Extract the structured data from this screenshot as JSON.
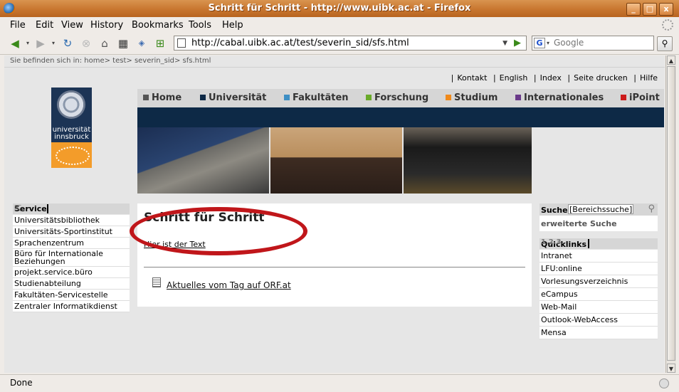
{
  "window": {
    "title": "Schritt für Schritt - http://www.uibk.ac.at - Firefox",
    "minimize_label": "_",
    "maximize_label": "□",
    "close_label": "x"
  },
  "menubar": {
    "items": [
      {
        "label": "File"
      },
      {
        "label": "Edit"
      },
      {
        "label": "View"
      },
      {
        "label": "History"
      },
      {
        "label": "Bookmarks"
      },
      {
        "label": "Tools"
      },
      {
        "label": "Help"
      }
    ]
  },
  "toolbar": {
    "url": "http://cabal.uibk.ac.at/test/severin_sid/sfs.html",
    "search_placeholder": "Google"
  },
  "page": {
    "breadcrumb": "Sie befinden sich in: home> test> severin_sid> sfs.html",
    "toplinks": [
      "Kontakt",
      "English",
      "Index",
      "Seite drucken",
      "Hilfe"
    ],
    "logo_text": "universität innsbruck",
    "mainnav": [
      {
        "label": "Home",
        "color": "#555555"
      },
      {
        "label": "Universität",
        "color": "#0d2946"
      },
      {
        "label": "Fakultäten",
        "color": "#3e8fc4"
      },
      {
        "label": "Forschung",
        "color": "#6aaa2a"
      },
      {
        "label": "Studium",
        "color": "#f08a1c"
      },
      {
        "label": "Internationales",
        "color": "#6a3a8a"
      },
      {
        "label": "iPoint",
        "color": "#cc1a1a"
      }
    ],
    "service": {
      "title": "Service",
      "items": [
        "Universitätsbibliothek",
        "Universitäts-Sportinstitut",
        "Sprachenzentrum",
        "Büro für Internationale Beziehungen",
        "projekt.service.büro",
        "Studienabteilung",
        "Fakultäten-Servicestelle",
        "Zentraler Informatikdienst"
      ]
    },
    "main": {
      "heading": "Schritt für Schritt",
      "text": "Hier ist der Text",
      "link": "Aktuelles vom Tag auf ORF.at"
    },
    "search": {
      "label": "Suche",
      "value": "[Bereichssuche]",
      "extended": "erweiterte Suche"
    },
    "quicklinks": {
      "title": "Quicklinks",
      "steps": "1.2.3.",
      "items": [
        "Intranet",
        "LFU:online",
        "Vorlesungsverzeichnis",
        "eCampus",
        "Web-Mail",
        "Outlook-WebAccess",
        "Mensa"
      ]
    }
  },
  "status": {
    "text": "Done"
  }
}
